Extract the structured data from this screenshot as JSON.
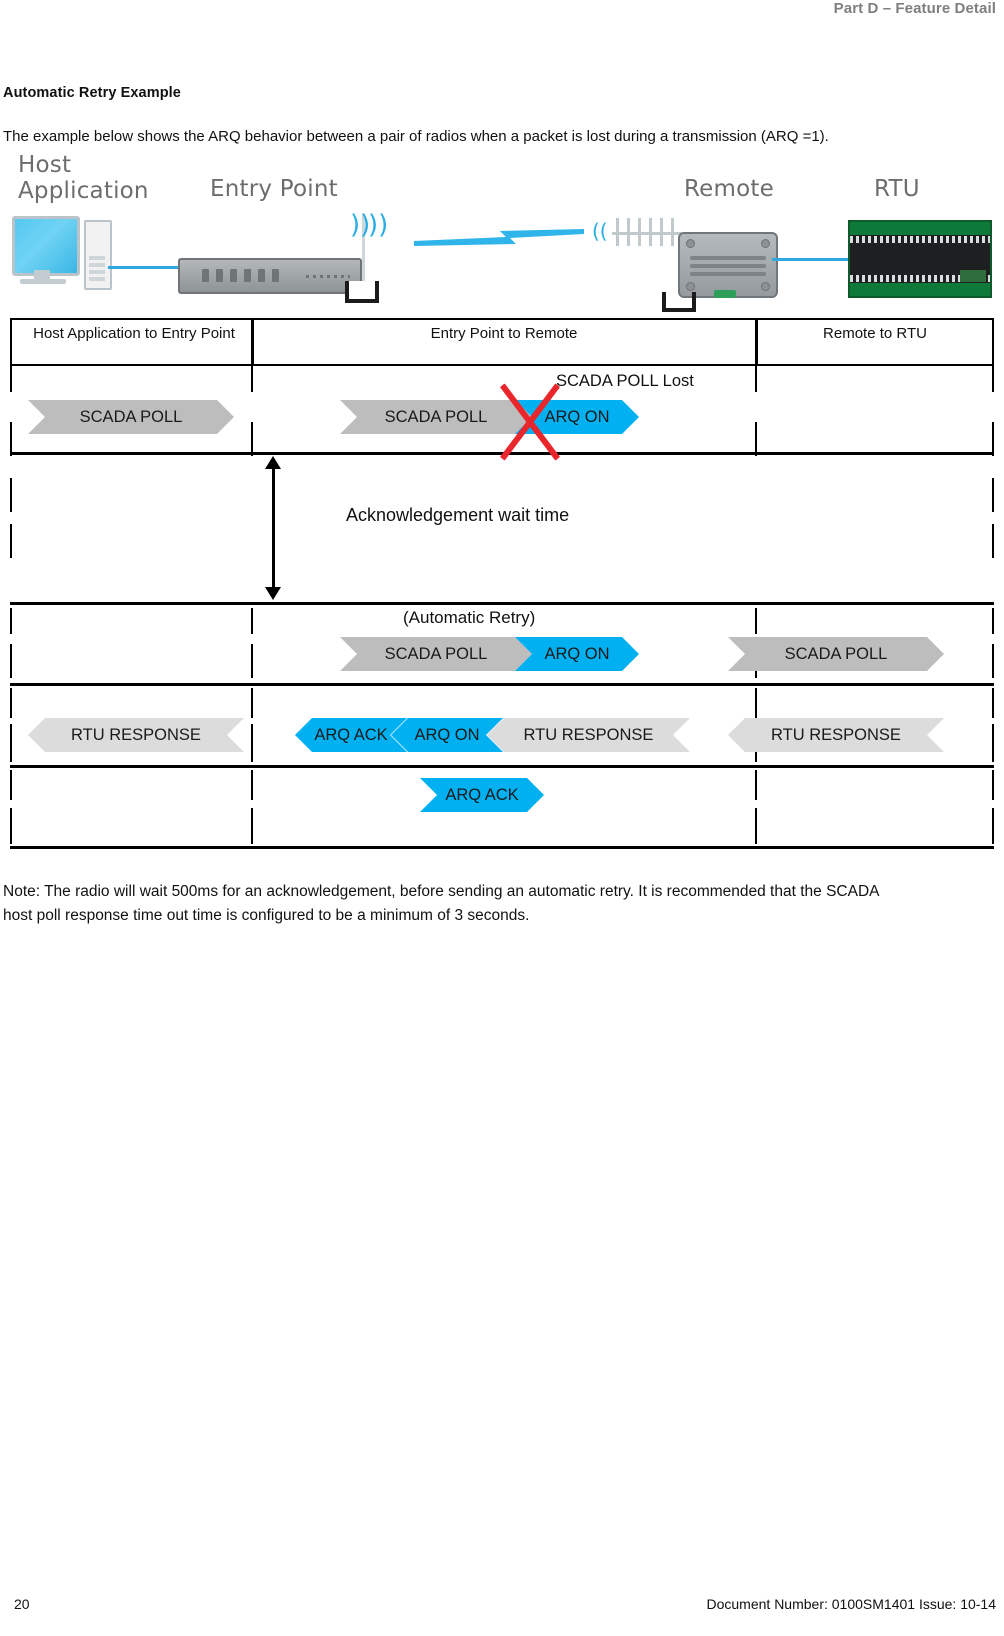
{
  "header": {
    "running_head": "Part D – Feature Detail"
  },
  "section": {
    "title": "Automatic Retry Example",
    "intro": "The example below shows the ARQ behavior between a pair of radios when a packet is lost during a transmission (ARQ =1).",
    "note": "Note: The radio will wait 500ms for an acknowledgement, before sending an automatic retry. It is recommended that the SCADA host poll response time out time is configured to be a minimum of 3 seconds."
  },
  "diagram": {
    "captions": {
      "host_application": "Host\nApplication",
      "entry_point": "Entry Point",
      "remote": "Remote",
      "rtu": "RTU"
    },
    "columns": [
      {
        "label": "Host Application to Entry Point"
      },
      {
        "label": "Entry Point to Remote"
      },
      {
        "label": "Remote to RTU"
      }
    ],
    "annotations": {
      "scada_poll_lost": "SCADA POLL Lost",
      "ack_wait_time": "Acknowledgement wait time",
      "automatic_retry": "(Automatic Retry)"
    },
    "messages": {
      "scada_poll": "SCADA POLL",
      "arq_on": "ARQ ON",
      "rtu_response": "RTU RESPONSE",
      "arq_ack": "ARQ ACK"
    },
    "colors": {
      "cyan": "#00B0F0",
      "gray": "#BDBDBD",
      "gray_light": "#DCDCDC",
      "red": "#E8262B",
      "header_gray": "#7F7F7F"
    }
  },
  "footer": {
    "page_number": "20",
    "document_info": "Document Number: 0100SM1401   Issue: 10-14"
  }
}
